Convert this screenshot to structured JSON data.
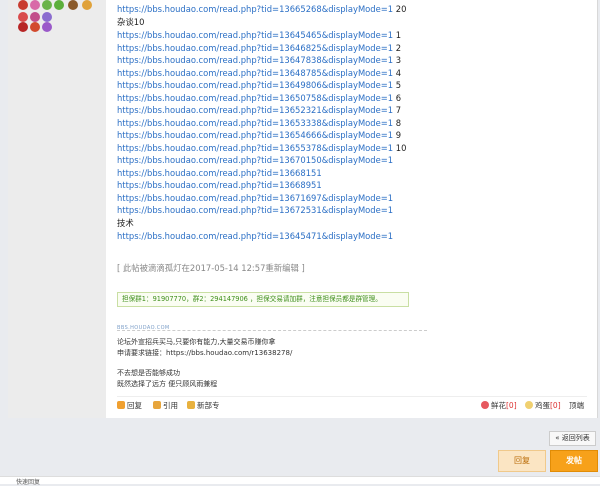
{
  "post": {
    "links_top": [
      {
        "url": "https://bbs.houdao.com/read.php?tid=13665268&displayMode=1",
        "suffix": " 20"
      }
    ],
    "group_10_label": "杂谈10",
    "links_group": [
      {
        "url": "https://bbs.houdao.com/read.php?tid=13645465&displayMode=1",
        "suffix": " 1"
      },
      {
        "url": "https://bbs.houdao.com/read.php?tid=13646825&displayMode=1",
        "suffix": " 2"
      },
      {
        "url": "https://bbs.houdao.com/read.php?tid=13647838&displayMode=1",
        "suffix": " 3"
      },
      {
        "url": "https://bbs.houdao.com/read.php?tid=13648785&displayMode=1",
        "suffix": " 4"
      },
      {
        "url": "https://bbs.houdao.com/read.php?tid=13649806&displayMode=1",
        "suffix": " 5"
      },
      {
        "url": "https://bbs.houdao.com/read.php?tid=13650758&displayMode=1",
        "suffix": " 6"
      },
      {
        "url": "https://bbs.houdao.com/read.php?tid=13652321&displayMode=1",
        "suffix": " 7"
      },
      {
        "url": "https://bbs.houdao.com/read.php?tid=13653338&displayMode=1",
        "suffix": "  8"
      },
      {
        "url": "https://bbs.houdao.com/read.php?tid=13654666&displayMode=1",
        "suffix": " 9"
      },
      {
        "url": "https://bbs.houdao.com/read.php?tid=13655378&displayMode=1",
        "suffix": " 10"
      },
      {
        "url": "https://bbs.houdao.com/read.php?tid=13670150&displayMode=1",
        "suffix": ""
      },
      {
        "url": "https://bbs.houdao.com/read.php?tid=13668151",
        "suffix": ""
      },
      {
        "url": "https://bbs.houdao.com/read.php?tid=13668951",
        "suffix": ""
      },
      {
        "url": "https://bbs.houdao.com/read.php?tid=13671697&displayMode=1",
        "suffix": ""
      },
      {
        "url": "https://bbs.houdao.com/read.php?tid=13672531&displayMode=1",
        "suffix": ""
      }
    ],
    "tech_label": "技术",
    "links_tech": [
      {
        "url": "https://bbs.houdao.com/read.php?tid=13645471&displayMode=1",
        "suffix": ""
      }
    ],
    "edit_note": "[ 此帖被滴滴孤灯在2017-05-14 12:57重新编辑 ]",
    "guarantee_notice": "担保群1：91907770，群2：294147906 ，担保交易请加群，注意担保员都是群管理。",
    "signature": {
      "logo_text": "BBS.HOUDAO.COM",
      "line1": "论坛外宣招兵买马,只要你有能力,大量交易币赚你拿",
      "line2": "申请要求链接：https://bbs.houdao.com/r13638278/",
      "line3": "不去想是否能够成功",
      "line4": "既然选择了远方 便只顾风雨兼程"
    }
  },
  "actions": {
    "reply_label": "回复",
    "quote_label": "引用",
    "new_post_label": "新部专",
    "flower_label": "鲜花",
    "flower_count": "[0]",
    "egg_label": "鸡蛋",
    "egg_count": "[0]",
    "top_label": "顶端"
  },
  "footer": {
    "back_to_list": "« 返回列表",
    "reply_button": "回复",
    "send_button": "发帖",
    "bottom_text": "快速回复"
  },
  "colors": {
    "link": "#2b6fc5",
    "send_button": "#f7a11a",
    "reply_button": "#fbe5c3"
  }
}
